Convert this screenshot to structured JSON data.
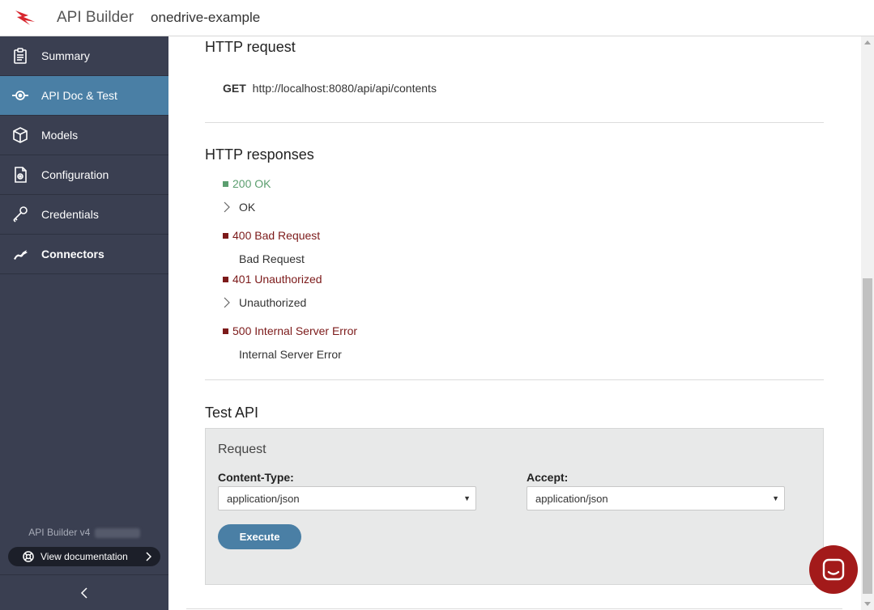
{
  "header": {
    "app_name": "API Builder",
    "project_name": "onedrive-example"
  },
  "sidebar": {
    "items": [
      {
        "label": "Summary",
        "icon": "clipboard-icon"
      },
      {
        "label": "API Doc & Test",
        "icon": "api-node-icon",
        "active": true
      },
      {
        "label": "Models",
        "icon": "cube-icon"
      },
      {
        "label": "Configuration",
        "icon": "config-file-icon"
      },
      {
        "label": "Credentials",
        "icon": "key-icon"
      },
      {
        "label": "Connectors",
        "icon": "plug-icon"
      }
    ],
    "version_label": "API Builder v4",
    "docs_label": "View documentation"
  },
  "main": {
    "http_request": {
      "heading": "HTTP request",
      "method": "GET",
      "url": "http://localhost:8080/api/api/contents"
    },
    "http_responses": {
      "heading": "HTTP responses",
      "items": [
        {
          "code": "200 OK",
          "description": "OK"
        },
        {
          "code": "400 Bad Request",
          "description": "Bad Request"
        },
        {
          "code": "401 Unauthorized",
          "description": "Unauthorized"
        },
        {
          "code": "500 Internal Server Error",
          "description": "Internal Server Error"
        }
      ]
    },
    "test_api": {
      "heading": "Test API",
      "panel_title": "Request",
      "content_type_label": "Content-Type:",
      "content_type_value": "application/json",
      "accept_label": "Accept:",
      "accept_value": "application/json",
      "execute_label": "Execute"
    }
  },
  "colors": {
    "accent": "#4a7fa5",
    "sidebar_bg": "#3a3f51",
    "status_ok": "#5b9e6f",
    "status_error": "#7c1a1a",
    "chat_button": "#a31a1a"
  }
}
